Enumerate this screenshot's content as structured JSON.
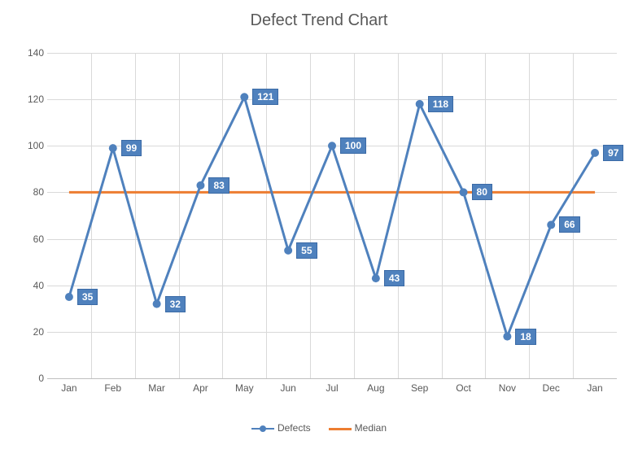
{
  "chart_data": {
    "type": "line",
    "title": "Defect Trend Chart",
    "categories": [
      "Jan",
      "Feb",
      "Mar",
      "Apr",
      "May",
      "Jun",
      "Jul",
      "Aug",
      "Sep",
      "Oct",
      "Nov",
      "Dec",
      "Jan"
    ],
    "series": [
      {
        "name": "Defects",
        "values": [
          35,
          99,
          32,
          83,
          121,
          55,
          100,
          43,
          118,
          80,
          18,
          66,
          97
        ],
        "color": "#4f81bd"
      },
      {
        "name": "Median",
        "values": [
          80,
          80,
          80,
          80,
          80,
          80,
          80,
          80,
          80,
          80,
          80,
          80,
          80
        ],
        "color": "#ed7d31"
      }
    ],
    "ylim": [
      0,
      140
    ],
    "ystep": 20,
    "xlabel": "",
    "ylabel": ""
  },
  "defects_data_labels": [
    "35",
    "99",
    "32",
    "83",
    "121",
    "55",
    "100",
    "43",
    "118",
    "80",
    "18",
    "66",
    "97"
  ],
  "legend": {
    "defects": "Defects",
    "median": "Median"
  }
}
